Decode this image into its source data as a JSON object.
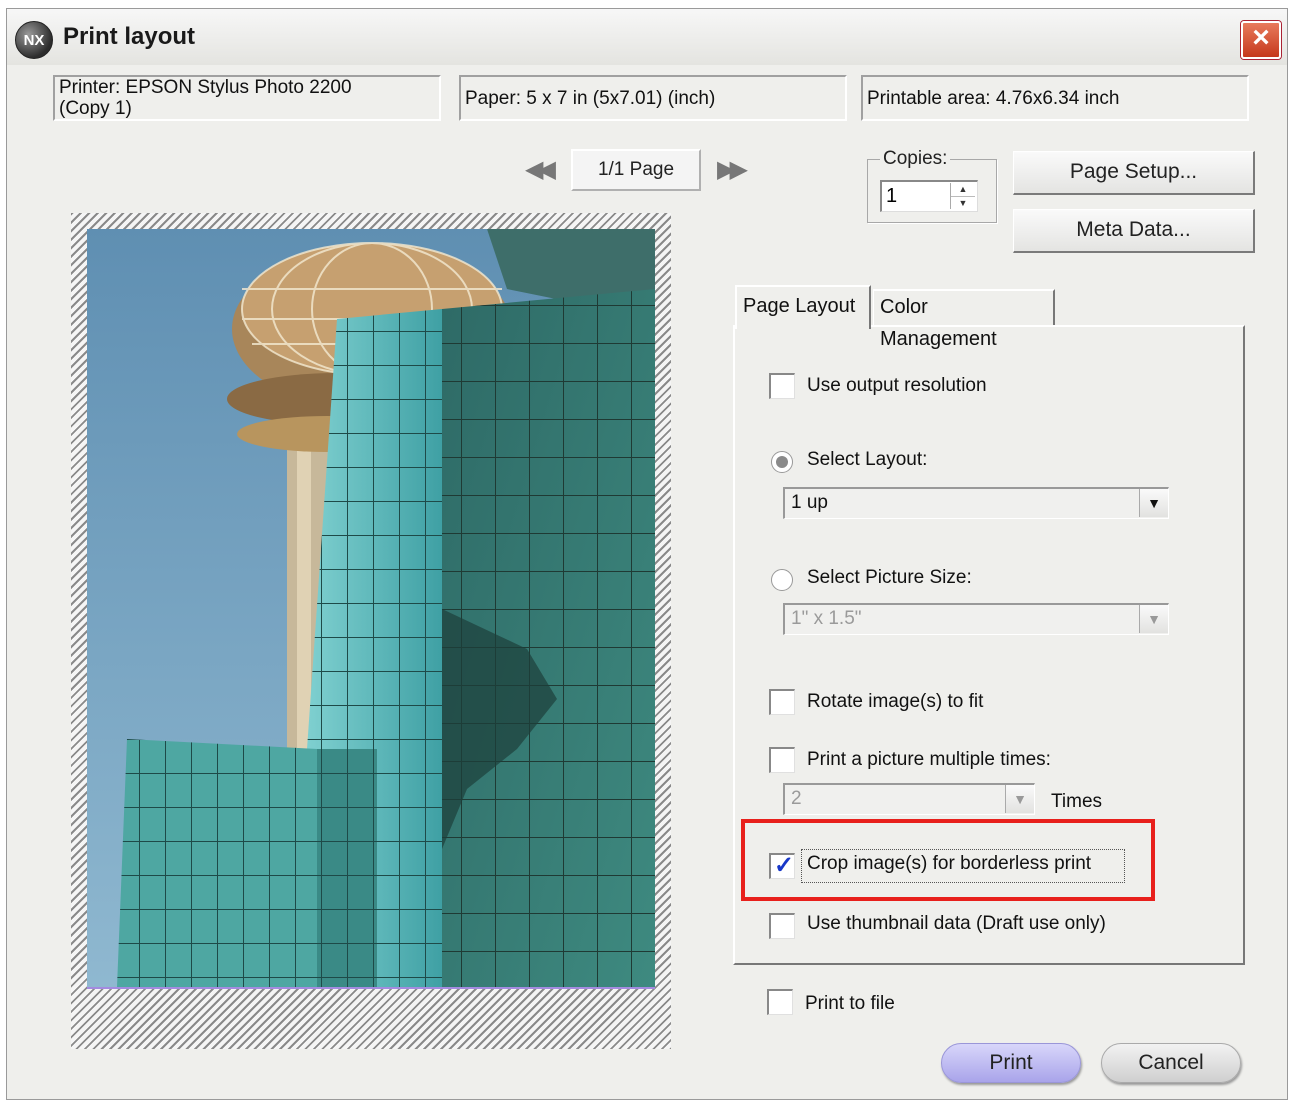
{
  "window": {
    "title": "Print layout",
    "logo_text": "NX",
    "close_icon": "close-icon"
  },
  "info": {
    "printer": "Printer:  EPSON Stylus Photo 2200\n(Copy 1)",
    "paper": "Paper:  5 x 7 in (5x7.01) (inch)",
    "printable_area": "Printable area:  4.76x6.34 inch"
  },
  "pager": {
    "prev_icon": "rewind-icon",
    "next_icon": "fast-forward-icon",
    "page_label": "1/1 Page"
  },
  "copies": {
    "label": "Copies:",
    "value": "1"
  },
  "buttons": {
    "page_setup": "Page Setup...",
    "meta_data": "Meta Data...",
    "print": "Print",
    "cancel": "Cancel"
  },
  "tabs": [
    {
      "label": "Page Layout",
      "active": true
    },
    {
      "label": "Color Management",
      "active": false
    }
  ],
  "page_layout": {
    "use_output_resolution": {
      "label": "Use output resolution",
      "checked": false
    },
    "select_layout": {
      "label": "Select Layout:",
      "selected": true,
      "value": "1 up"
    },
    "select_picture_size": {
      "label": "Select Picture Size:",
      "selected": false,
      "value": "1\" x 1.5\""
    },
    "rotate_to_fit": {
      "label": "Rotate image(s) to fit",
      "checked": false
    },
    "print_multiple": {
      "label": "Print a picture multiple times:",
      "checked": false,
      "times_value": "2",
      "times_label": "Times"
    },
    "crop_borderless": {
      "label": "Crop image(s) for borderless print",
      "checked": true
    },
    "use_thumbnail": {
      "label": "Use thumbnail data (Draft use only)",
      "checked": false
    }
  },
  "print_to_file": {
    "label": "Print to file",
    "checked": false
  },
  "colors": {
    "highlight": "#e8201c",
    "print_button": "#b8b4f0",
    "check": "#1838c8"
  }
}
